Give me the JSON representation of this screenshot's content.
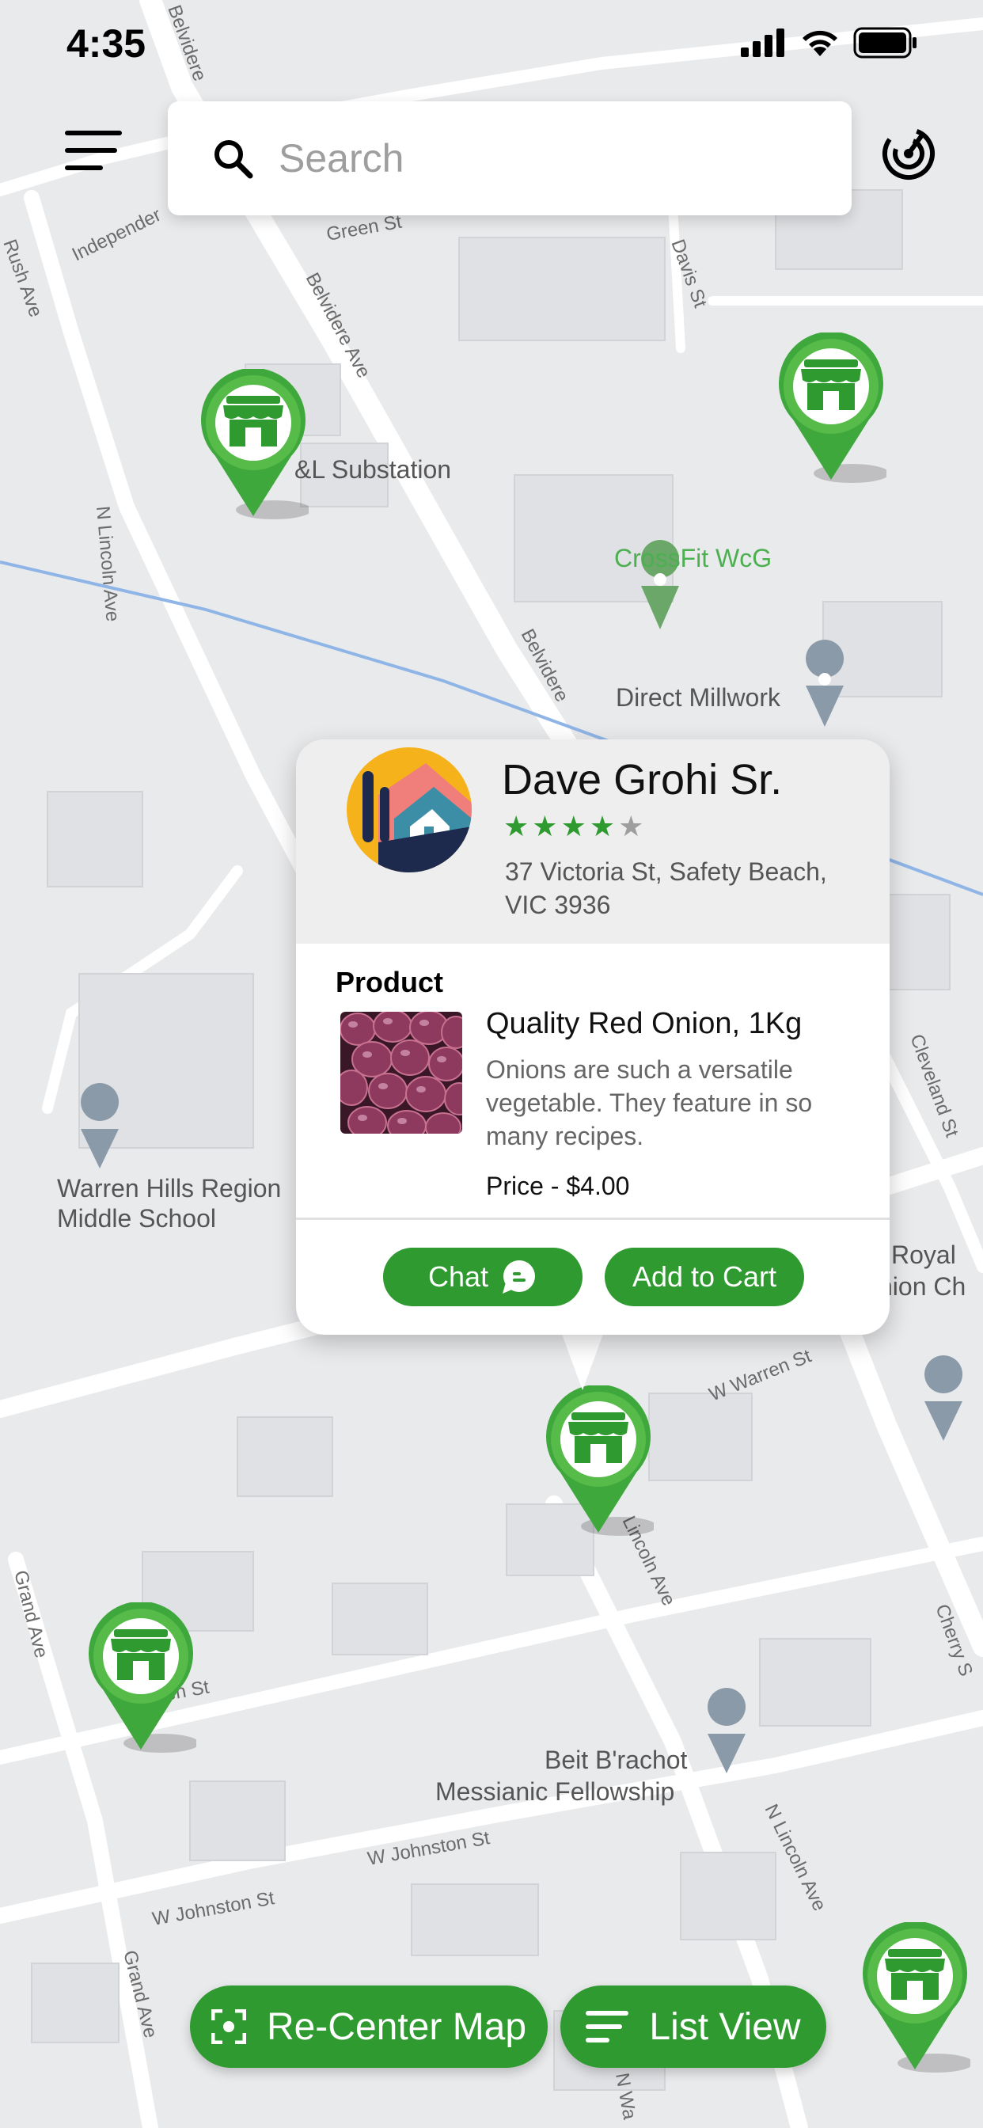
{
  "status_bar": {
    "time": "4:35"
  },
  "search": {
    "placeholder": "Search"
  },
  "map": {
    "place_labels": [
      "&L Substation",
      "CrossFit WcG",
      "Direct Millwork",
      "Warren Hills Region",
      "Middle School",
      "Royal",
      "nion Ch",
      "Beit B'rachot",
      "Messianic Fellowship"
    ],
    "street_labels": [
      "Belvidere",
      "Independer",
      "Green St",
      "Davis St",
      "Rush Ave",
      "Belvidere Ave",
      "N Lincoln Ave",
      "Belvidere",
      "Cleveland St",
      "W Warren St",
      "Lincoln Ave",
      "Cherry S",
      "Grand Ave",
      "en St",
      "W Johnston St",
      "W Johnston St",
      "N Lincoln Ave",
      "Grand Ave",
      "N Wa"
    ]
  },
  "popup": {
    "seller_name": "Dave Grohi Sr.",
    "rating": 4,
    "rating_max": 5,
    "address": "37 Victoria St, Safety Beach, VIC 3936",
    "product_heading": "Product",
    "product_title": "Quality Red Onion, 1Kg",
    "product_description": "Onions are such a versatile vegetable. They feature in so many recipes.",
    "product_price": "Price - $4.00",
    "chat_label": "Chat",
    "add_to_cart_label": "Add to Cart"
  },
  "bottom_bar": {
    "recenter_label": "Re-Center Map",
    "list_view_label": "List View"
  },
  "colors": {
    "accent": "#2e9a2f",
    "star_filled": "#2e9a2f",
    "star_empty": "#9e9e9e",
    "map_background": "#e9eaec"
  },
  "icons": {
    "menu": "hamburger-menu-icon",
    "search": "search-icon",
    "radar": "radar-icon",
    "store_pin": "store-pin-icon",
    "chat": "chat-bubble-icon",
    "recenter": "recenter-icon",
    "list": "list-icon"
  }
}
